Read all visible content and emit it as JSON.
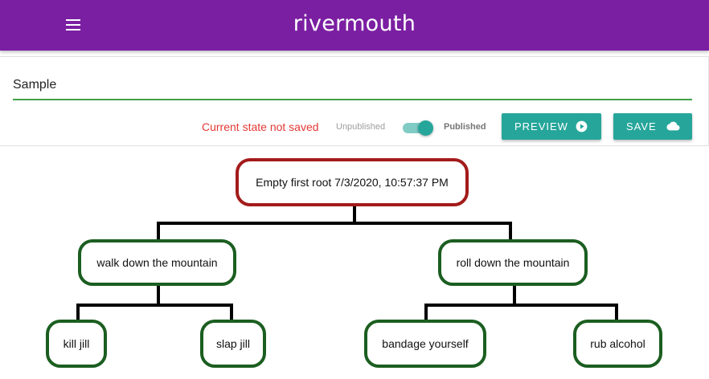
{
  "app": {
    "title": "rivermouth"
  },
  "editor": {
    "name_value": "Sample",
    "status": "Current state not saved",
    "unpublished_label": "Unpublished",
    "published_label": "Published",
    "published": true,
    "preview_label": "PREVIEW",
    "save_label": "SAVE"
  },
  "colors": {
    "appbar": "#7b1fa2",
    "accent": "#26a69a",
    "status": "#e53935",
    "root_border": "#a31b1b",
    "node_border": "#1b5e20"
  },
  "icons": {
    "menu": "menu-icon",
    "preview": "play-circle-icon",
    "save": "cloud-icon"
  },
  "tree": {
    "root": {
      "label": "Empty first root 7/3/2020, 10:57:37 PM"
    },
    "children": [
      {
        "label": "walk down the mountain",
        "children": [
          {
            "label": "kill jill"
          },
          {
            "label": "slap jill"
          }
        ]
      },
      {
        "label": "roll down the mountain",
        "children": [
          {
            "label": "bandage yourself"
          },
          {
            "label": "rub alcohol"
          }
        ]
      }
    ]
  }
}
